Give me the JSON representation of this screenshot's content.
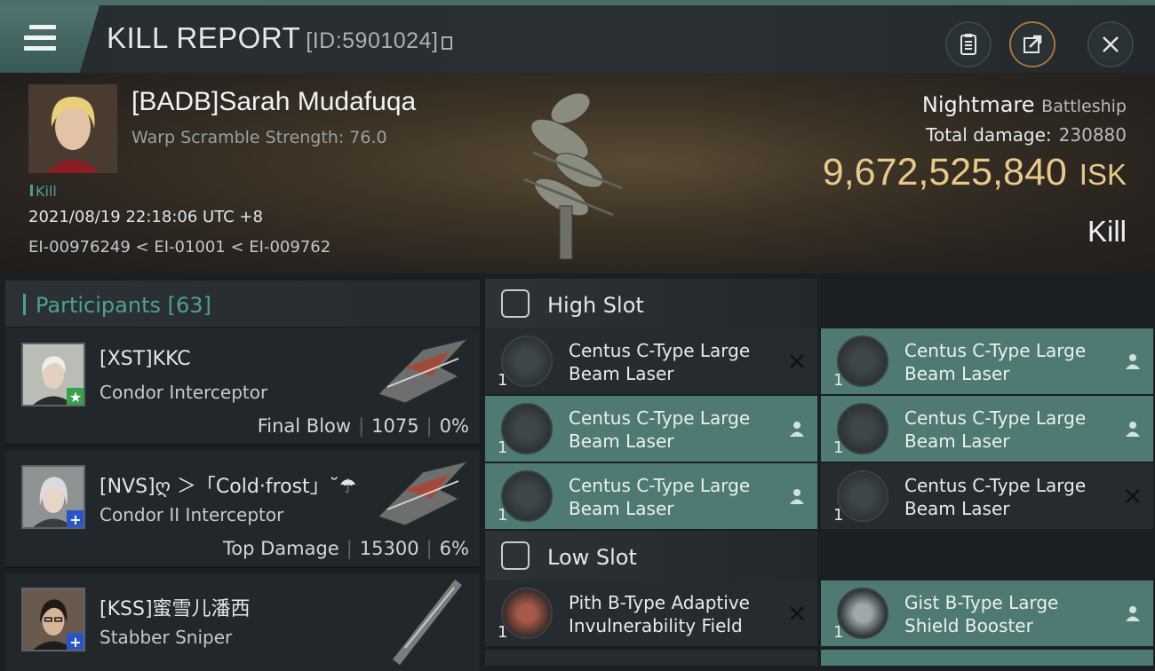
{
  "header": {
    "title": "KILL REPORT",
    "report_id": "[ID:5901024]"
  },
  "icons": {
    "menu": "hamburger-icon",
    "report_id_copy": "copy-icon",
    "clipboard": "clipboard-icon",
    "share": "share-icon",
    "close": "close-icon"
  },
  "colors": {
    "accent": "#4f9f96",
    "isk": "#e8c989",
    "teal_row": "#4e7a73",
    "dark_row": "#262b2f"
  },
  "victim": {
    "name": "[BADB]Sarah Mudafuqa",
    "scram": "Warp Scramble Strength: 76.0",
    "tag": "Kill",
    "datetime": "2021/08/19 22:18:06 UTC +8",
    "system": "EI-00976249 < EI-01001 < EI-009762",
    "ship": "Nightmare",
    "ship_class": "Battleship",
    "damage_label": "Total damage:",
    "damage_value": "230880",
    "isk_value": "9,672,525,840",
    "isk_unit": "ISK",
    "type": "Kill"
  },
  "participants": {
    "header": "Participants [63]",
    "items": [
      {
        "name": "[XST]KKC",
        "ship": "Condor Interceptor",
        "role": "Final Blow",
        "damage": "1075",
        "percent": "0%",
        "badge": "star-icon",
        "badge_color": "#3aa04a"
      },
      {
        "name": "[NVS]ღ ＞「Cold·frost」˘☂",
        "ship": "Condor II Interceptor",
        "role": "Top Damage",
        "damage": "15300",
        "percent": "6%",
        "badge": "plus-icon",
        "badge_color": "#2a55c8"
      },
      {
        "name": "[KSS]蜜雪儿潘西",
        "ship": "Stabber Sniper",
        "role": "",
        "damage": "",
        "percent": "",
        "badge": "plus-icon",
        "badge_color": "#2a55c8"
      }
    ]
  },
  "slots": {
    "high": {
      "label": "High Slot",
      "modules": [
        {
          "name_line1": "Centus C-Type Large",
          "name_line2": "Beam Laser",
          "qty": "1",
          "status": "destroyed"
        },
        {
          "name_line1": "Centus C-Type Large",
          "name_line2": "Beam Laser",
          "qty": "1",
          "status": "dropped"
        },
        {
          "name_line1": "Centus C-Type Large",
          "name_line2": "Beam Laser",
          "qty": "1",
          "status": "dropped"
        },
        {
          "name_line1": "Centus C-Type Large",
          "name_line2": "Beam Laser",
          "qty": "1",
          "status": "dropped"
        },
        {
          "name_line1": "Centus C-Type Large",
          "name_line2": "Beam Laser",
          "qty": "1",
          "status": "dropped"
        },
        {
          "name_line1": "Centus C-Type Large",
          "name_line2": "Beam Laser",
          "qty": "1",
          "status": "destroyed"
        }
      ]
    },
    "low": {
      "label": "Low Slot",
      "modules": [
        {
          "name_line1": "Pith B-Type Adaptive",
          "name_line2": "Invulnerability Field",
          "qty": "1",
          "status": "destroyed"
        },
        {
          "name_line1": "Gist B-Type Large",
          "name_line2": "Shield Booster",
          "qty": "1",
          "status": "dropped"
        }
      ]
    }
  }
}
